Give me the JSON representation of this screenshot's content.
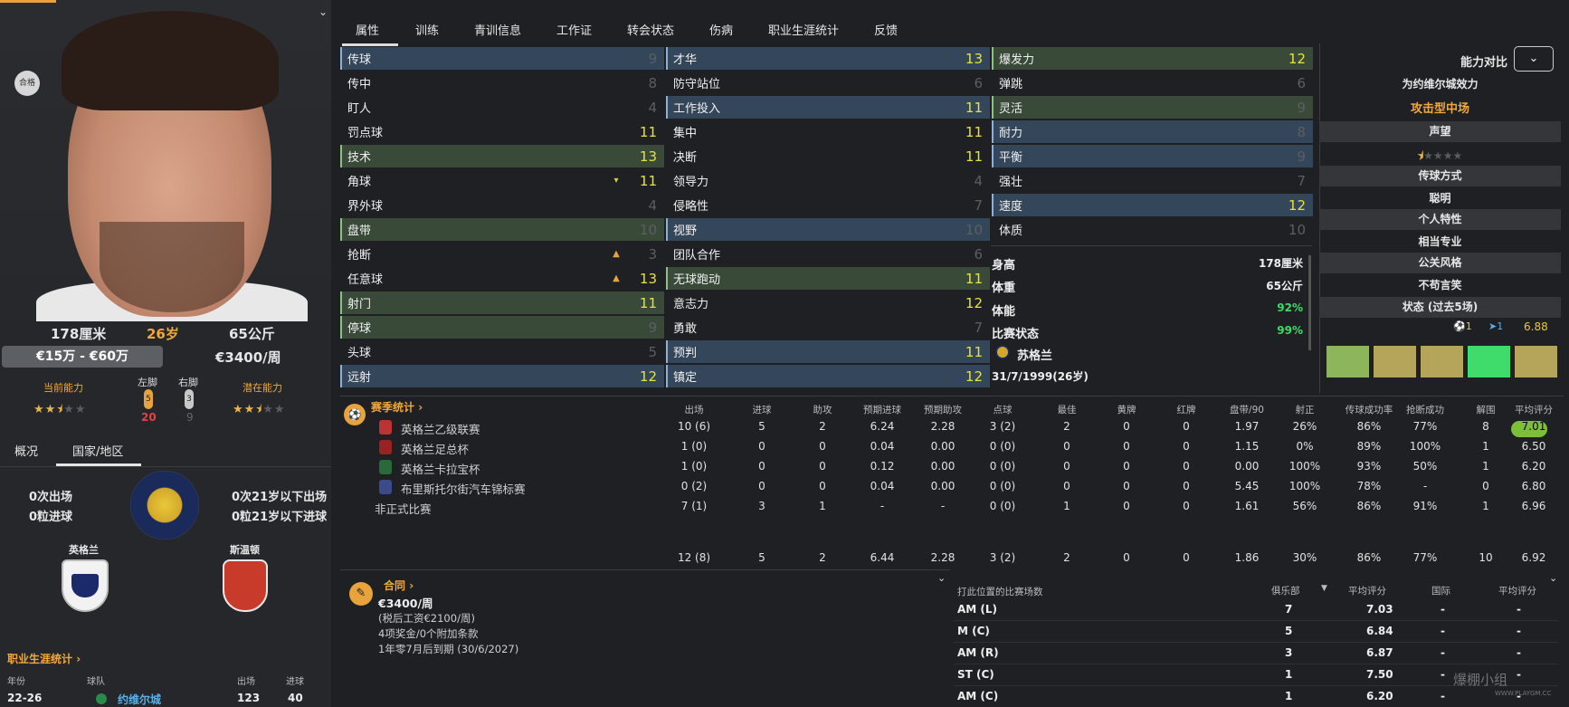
{
  "player": {
    "height": "178厘米",
    "age": "26岁",
    "weight": "65公斤",
    "value": "€15万 - €60万",
    "wage": "€3400/周",
    "badge": "合格",
    "current_ability_label": "当前能力",
    "potential_ability_label": "潜在能力",
    "current_ability_stars": 2.5,
    "potential_ability_stars": 2.5,
    "left_foot_label": "左脚",
    "right_foot_label": "右脚",
    "left_foot": "5",
    "right_foot": "3",
    "left_foot_sub": "20",
    "right_foot_sub": "9"
  },
  "left_tabs": [
    "概况",
    "国家/地区"
  ],
  "nation": {
    "caps": "0次出场",
    "goals": "0粒进球",
    "u21_caps": "0次21岁以下出场",
    "u21_goals": "0粒21岁以下进球",
    "birth_nation": "英格兰",
    "birth_town": "斯温顿"
  },
  "career": {
    "link": "职业生涯统计",
    "headers": [
      "年份",
      "球队",
      "出场",
      "进球"
    ],
    "row": [
      "22-26",
      "约维尔城",
      "123",
      "40"
    ]
  },
  "top_tabs": [
    "属性",
    "训练",
    "青训信息",
    "工作证",
    "转会状态",
    "伤病",
    "职业生涯统计",
    "反馈"
  ],
  "technical": [
    {
      "name": "传球",
      "value": "9",
      "hl": "blue",
      "dim": true
    },
    {
      "name": "传中",
      "value": "8",
      "hl": "",
      "dim": true
    },
    {
      "name": "盯人",
      "value": "4",
      "hl": "",
      "dim": true
    },
    {
      "name": "罚点球",
      "value": "11",
      "hl": "",
      "dim": false
    },
    {
      "name": "技术",
      "value": "13",
      "hl": "green",
      "dim": false
    },
    {
      "name": "角球",
      "value": "11",
      "hl": "",
      "dim": false,
      "arrow": "▾"
    },
    {
      "name": "界外球",
      "value": "4",
      "hl": "",
      "dim": true
    },
    {
      "name": "盘带",
      "value": "10",
      "hl": "green",
      "dim": true
    },
    {
      "name": "抢断",
      "value": "3",
      "hl": "",
      "dim": true,
      "arrow": "▲"
    },
    {
      "name": "任意球",
      "value": "13",
      "hl": "",
      "dim": false,
      "arrow": "▲"
    },
    {
      "name": "射门",
      "value": "11",
      "hl": "green",
      "dim": false
    },
    {
      "name": "停球",
      "value": "9",
      "hl": "green",
      "dim": true
    },
    {
      "name": "头球",
      "value": "5",
      "hl": "",
      "dim": true
    },
    {
      "name": "远射",
      "value": "12",
      "hl": "blue",
      "dim": false
    }
  ],
  "mental": [
    {
      "name": "才华",
      "value": "13",
      "hl": "blue",
      "dim": false
    },
    {
      "name": "防守站位",
      "value": "6",
      "hl": "",
      "dim": true
    },
    {
      "name": "工作投入",
      "value": "11",
      "hl": "blue",
      "dim": false
    },
    {
      "name": "集中",
      "value": "11",
      "hl": "",
      "dim": false
    },
    {
      "name": "决断",
      "value": "11",
      "hl": "",
      "dim": false
    },
    {
      "name": "领导力",
      "value": "4",
      "hl": "",
      "dim": true
    },
    {
      "name": "侵略性",
      "value": "7",
      "hl": "",
      "dim": true
    },
    {
      "name": "视野",
      "value": "10",
      "hl": "blue",
      "dim": true
    },
    {
      "name": "团队合作",
      "value": "6",
      "hl": "",
      "dim": true
    },
    {
      "name": "无球跑动",
      "value": "11",
      "hl": "green",
      "dim": false
    },
    {
      "name": "意志力",
      "value": "12",
      "hl": "",
      "dim": false
    },
    {
      "name": "勇敢",
      "value": "7",
      "hl": "",
      "dim": true
    },
    {
      "name": "预判",
      "value": "11",
      "hl": "blue",
      "dim": false
    },
    {
      "name": "镇定",
      "value": "12",
      "hl": "blue",
      "dim": false
    }
  ],
  "physical": [
    {
      "name": "爆发力",
      "value": "12",
      "hl": "green",
      "dim": false
    },
    {
      "name": "弹跳",
      "value": "6",
      "hl": "",
      "dim": true
    },
    {
      "name": "灵活",
      "value": "9",
      "hl": "green",
      "dim": true
    },
    {
      "name": "耐力",
      "value": "8",
      "hl": "blue",
      "dim": true
    },
    {
      "name": "平衡",
      "value": "9",
      "hl": "blue",
      "dim": true
    },
    {
      "name": "强壮",
      "value": "7",
      "hl": "",
      "dim": true
    },
    {
      "name": "速度",
      "value": "12",
      "hl": "blue",
      "dim": false
    },
    {
      "name": "体质",
      "value": "10",
      "hl": "",
      "dim": true
    }
  ],
  "info": {
    "height_label": "身高",
    "height": "178厘米",
    "weight_label": "体重",
    "weight": "65公斤",
    "fitness_label": "体能",
    "fitness": "92%",
    "condition_label": "比赛状态",
    "condition": "99%",
    "nation": "苏格兰",
    "dob": "31/7/1999(26岁)"
  },
  "right": {
    "compare_label": "能力对比",
    "plays_for": "为约维尔城效力",
    "role": "攻击型中场",
    "reputation_label": "声望",
    "reputation_stars": 1,
    "passing_label": "传球方式",
    "passing": "聪明",
    "personality_label": "个人特性",
    "personality": "相当专业",
    "media_label": "公关风格",
    "media": "不苟言笑",
    "form_label": "状态 (过去5场)",
    "form_goals": "1",
    "form_assists": "1",
    "form_rating": "6.88",
    "form_colors": [
      "#8db65c",
      "#b5a55a",
      "#b5a55a",
      "#3fdc6c",
      "#b5a55a"
    ]
  },
  "season": {
    "title": "赛季统计",
    "headers": [
      "出场",
      "进球",
      "助攻",
      "预期进球",
      "预期助攻",
      "点球",
      "最佳",
      "黄牌",
      "红牌",
      "盘带/90",
      "射正",
      "传球成功率",
      "抢断成功",
      "解围",
      "平均评分"
    ],
    "rows": [
      {
        "comp": "英格兰乙级联赛",
        "icon": "#b33",
        "cells": [
          "10 (6)",
          "5",
          "2",
          "6.24",
          "2.28",
          "3 (2)",
          "2",
          "0",
          "0",
          "1.97",
          "26%",
          "86%",
          "77%",
          "8",
          "7.01"
        ]
      },
      {
        "comp": "英格兰足总杯",
        "icon": "#922",
        "cells": [
          "1 (0)",
          "0",
          "0",
          "0.04",
          "0.00",
          "0 (0)",
          "0",
          "0",
          "0",
          "1.15",
          "0%",
          "89%",
          "100%",
          "1",
          "6.50"
        ]
      },
      {
        "comp": "英格兰卡拉宝杯",
        "icon": "#2a6a3a",
        "cells": [
          "1 (0)",
          "0",
          "0",
          "0.12",
          "0.00",
          "0 (0)",
          "0",
          "0",
          "0",
          "0.00",
          "100%",
          "93%",
          "50%",
          "1",
          "6.20"
        ]
      },
      {
        "comp": "布里斯托尔街汽车锦标赛",
        "icon": "#3a4a8a",
        "cells": [
          "0 (2)",
          "0",
          "0",
          "0.04",
          "0.00",
          "0 (0)",
          "0",
          "0",
          "0",
          "5.45",
          "100%",
          "78%",
          "-",
          "0",
          "6.80"
        ]
      },
      {
        "comp": "非正式比赛",
        "icon": "",
        "cells": [
          "7 (1)",
          "3",
          "1",
          "-",
          "-",
          "0 (0)",
          "1",
          "0",
          "0",
          "1.61",
          "56%",
          "86%",
          "91%",
          "1",
          "6.96"
        ]
      }
    ],
    "totals": [
      "12 (8)",
      "5",
      "2",
      "6.44",
      "2.28",
      "3 (2)",
      "2",
      "0",
      "0",
      "1.86",
      "30%",
      "86%",
      "77%",
      "10",
      "6.92"
    ]
  },
  "contract": {
    "title": "合同",
    "wage": "€3400/周",
    "net": "(税后工资€2100/周)",
    "bonus": "4项奖金/0个附加条款",
    "expiry": "1年零7月后到期 (30/6/2027)"
  },
  "positions": {
    "title": "打此位置的比赛场数",
    "headers": [
      "俱乐部",
      "平均评分",
      "国际",
      "平均评分"
    ],
    "rows": [
      [
        "AM (L)",
        "7",
        "7.03",
        "-",
        "-"
      ],
      [
        "M (C)",
        "5",
        "6.84",
        "-",
        "-"
      ],
      [
        "AM (R)",
        "3",
        "6.87",
        "-",
        "-"
      ],
      [
        "ST (C)",
        "1",
        "7.50",
        "-",
        "-"
      ],
      [
        "AM (C)",
        "1",
        "6.20",
        "-",
        "-"
      ]
    ]
  },
  "watermark": "爆棚小组",
  "watermark_url": "WWW.PLAYGM.CC"
}
